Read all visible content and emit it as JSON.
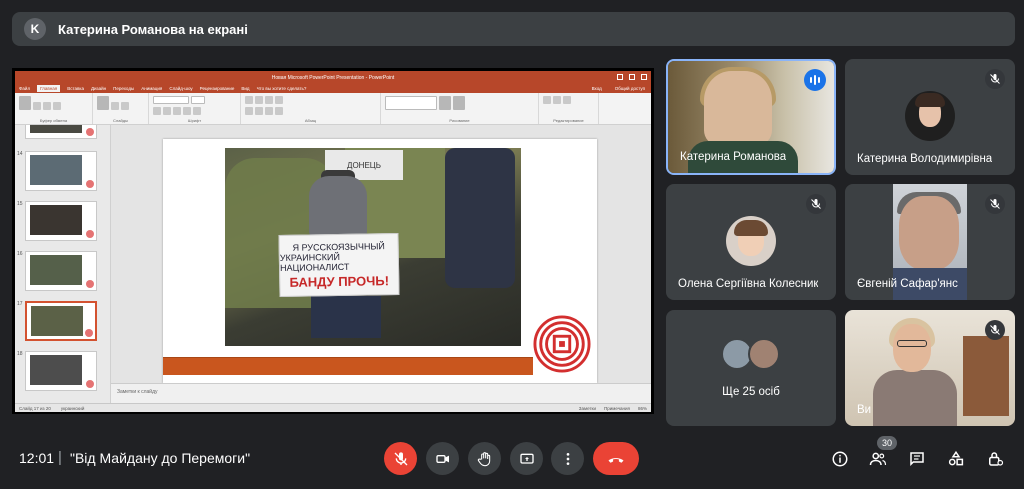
{
  "presenter_bar": {
    "avatar_letter": "K",
    "title": "Катерина Романова на екрані"
  },
  "ppt": {
    "window_title": "Новая Microsoft PowerPoint Presentation - PowerPoint",
    "tabs": [
      "Файл",
      "Главная",
      "Вставка",
      "Дизайн",
      "Переходы",
      "Анимация",
      "Слайд-шоу",
      "Рецензирование",
      "Вид"
    ],
    "active_tab": "Главная",
    "search_hint": "Что вы хотите сделать?",
    "signin": "Вход",
    "share": "Общий доступ",
    "ribbon_groups": [
      "Буфер обмена",
      "Слайды",
      "Шрифт",
      "Абзац",
      "Рисование",
      "Редактирование"
    ],
    "slide_numbers": [
      "14",
      "15",
      "16",
      "17",
      "18"
    ],
    "selected_slide": "17",
    "photo_sign_top": "ДОНЕЦЬ",
    "sign_line1": "Я РУССКОЯЗЫЧНЫЙ",
    "sign_line2": "УКРАИНСКИЙ НАЦИОНАЛИСТ",
    "sign_line3": "БАНДУ ПРОЧЬ!",
    "notes_placeholder": "Заметки к слайду",
    "status_slide": "Слайд 17 из 20",
    "status_lang": "украинский",
    "status_notes": "Заметки",
    "status_comments": "Примечания",
    "zoom": "86%"
  },
  "participants": [
    {
      "name": "Катерина Романова",
      "speaking": true
    },
    {
      "name": "Катерина Володимирівна",
      "muted": true
    },
    {
      "name": "Олена Сергіївна Колесник",
      "muted": true
    },
    {
      "name": "Євгеній Сафар'янс",
      "muted": true
    },
    {
      "name": "Ще 25 осіб"
    },
    {
      "name": "Ви",
      "muted": true
    }
  ],
  "bottom": {
    "time": "12:01",
    "separator": "|",
    "meeting_title": "\"Від Майдану до Перемоги\"",
    "participant_count": "30"
  },
  "colors": {
    "background": "#202124",
    "tile": "#3c4043",
    "accent_blue": "#1a73e8",
    "red": "#ea4335",
    "ppt_brand": "#b7472a"
  },
  "icons": [
    "mic-off-icon",
    "camera-icon",
    "raise-hand-icon",
    "present-icon",
    "more-icon",
    "end-call-icon",
    "info-icon",
    "people-icon",
    "chat-icon",
    "activities-icon",
    "lock-icon"
  ]
}
